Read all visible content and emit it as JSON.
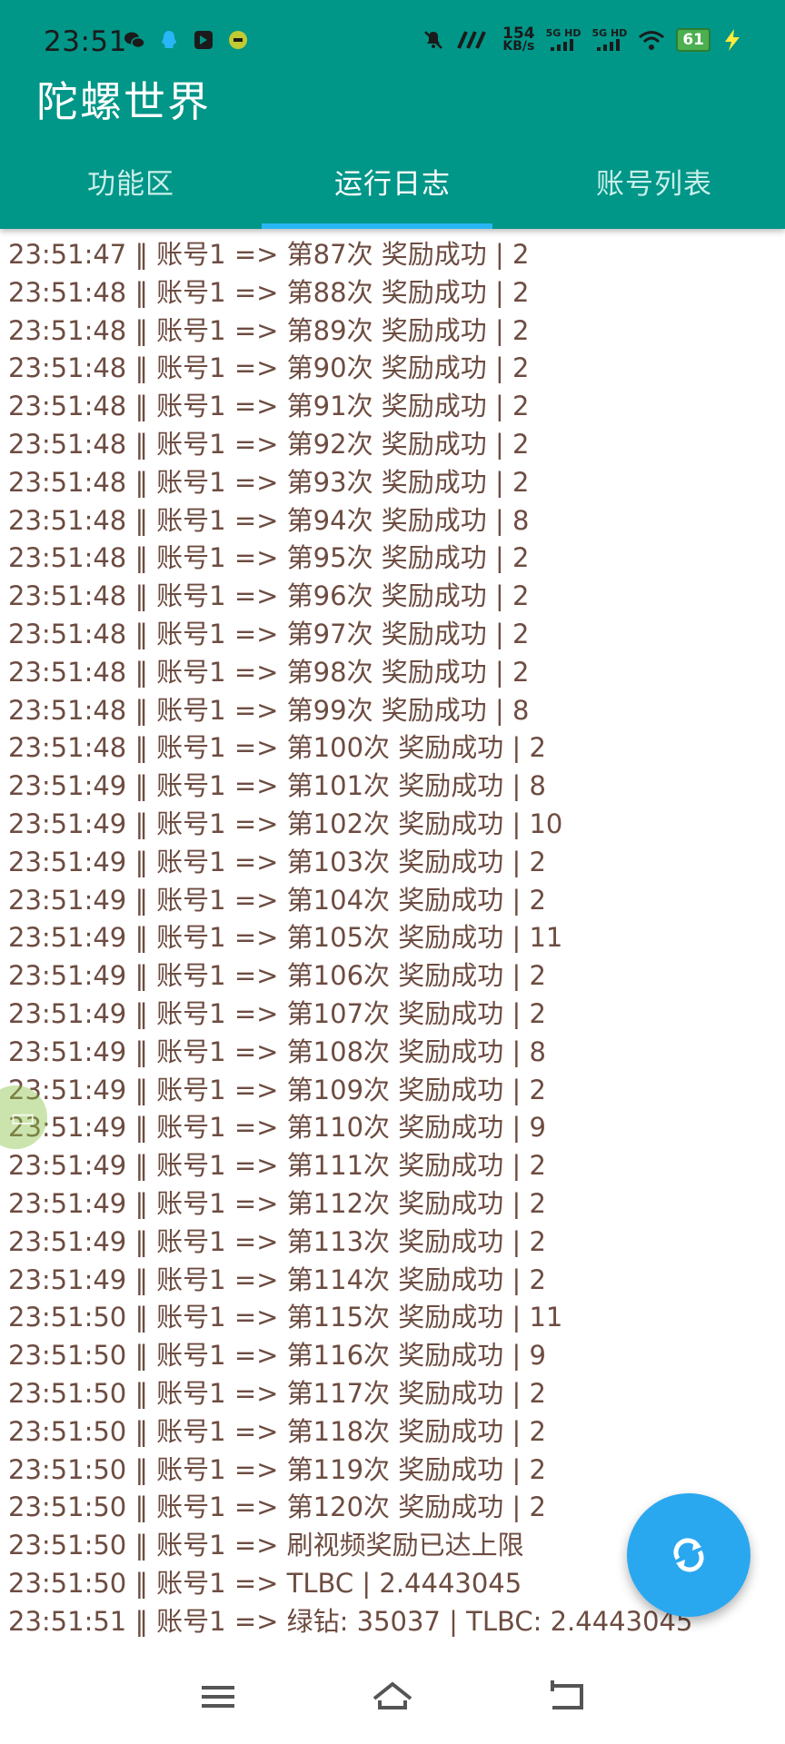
{
  "status_bar": {
    "time": "23:51",
    "net_speed": "154",
    "net_speed_unit": "KB/s",
    "sim1_label": "5G HD",
    "sim2_label": "5G HD",
    "battery": "61"
  },
  "app": {
    "title": "陀螺世界"
  },
  "tabs": [
    {
      "label": "功能区",
      "active": false
    },
    {
      "label": "运行日志",
      "active": true
    },
    {
      "label": "账号列表",
      "active": false
    }
  ],
  "log_lines": [
    "23:51:47  ‖  账号1  =>  第87次 奖励成功 | 2",
    "23:51:48  ‖  账号1  =>  第88次 奖励成功 | 2",
    "23:51:48  ‖  账号1  =>  第89次 奖励成功 | 2",
    "23:51:48  ‖  账号1  =>  第90次 奖励成功 | 2",
    "23:51:48  ‖  账号1  =>  第91次 奖励成功 | 2",
    "23:51:48  ‖  账号1  =>  第92次 奖励成功 | 2",
    "23:51:48  ‖  账号1  =>  第93次 奖励成功 | 2",
    "23:51:48  ‖  账号1  =>  第94次 奖励成功 | 8",
    "23:51:48  ‖  账号1  =>  第95次 奖励成功 | 2",
    "23:51:48  ‖  账号1  =>  第96次 奖励成功 | 2",
    "23:51:48  ‖  账号1  =>  第97次 奖励成功 | 2",
    "23:51:48  ‖  账号1  =>  第98次 奖励成功 | 2",
    "23:51:48  ‖  账号1  =>  第99次 奖励成功 | 8",
    "23:51:48  ‖  账号1  =>  第100次 奖励成功 | 2",
    "23:51:49  ‖  账号1  =>  第101次 奖励成功 | 8",
    "23:51:49  ‖  账号1  =>  第102次 奖励成功 | 10",
    "23:51:49  ‖  账号1  =>  第103次 奖励成功 | 2",
    "23:51:49  ‖  账号1  =>  第104次 奖励成功 | 2",
    "23:51:49  ‖  账号1  =>  第105次 奖励成功 | 11",
    "23:51:49  ‖  账号1  =>  第106次 奖励成功 | 2",
    "23:51:49  ‖  账号1  =>  第107次 奖励成功 | 2",
    "23:51:49  ‖  账号1  =>  第108次 奖励成功 | 8",
    "23:51:49  ‖  账号1  =>  第109次 奖励成功 | 2",
    "23:51:49  ‖  账号1  =>  第110次 奖励成功 | 9",
    "23:51:49  ‖  账号1  =>  第111次 奖励成功 | 2",
    "23:51:49  ‖  账号1  =>  第112次 奖励成功 | 2",
    "23:51:49  ‖  账号1  =>  第113次 奖励成功 | 2",
    "23:51:49  ‖  账号1  =>  第114次 奖励成功 | 2",
    "23:51:50  ‖  账号1  =>  第115次 奖励成功 | 11",
    "23:51:50  ‖  账号1  =>  第116次 奖励成功 | 9",
    "23:51:50  ‖  账号1  =>  第117次 奖励成功 | 2",
    "23:51:50  ‖  账号1  =>  第118次 奖励成功 | 2",
    "23:51:50  ‖  账号1  =>  第119次 奖励成功 | 2",
    "23:51:50  ‖  账号1  =>  第120次 奖励成功 | 2",
    "23:51:50  ‖  账号1  =>  刷视频奖励已达上限",
    "23:51:50  ‖  账号1  =>  TLBC |  2.4443045",
    "23:51:51  ‖  账号1  =>  绿钻: 35037 | TLBC: 2.4443045"
  ],
  "colors": {
    "primary": "#009688",
    "accent": "#29b6f6",
    "log_text": "#6d4c41",
    "fab": "#29a8f0"
  },
  "icons": {
    "fab": "refresh-icon",
    "nav_menu": "menu-icon",
    "nav_home": "home-icon",
    "nav_back": "back-icon"
  }
}
